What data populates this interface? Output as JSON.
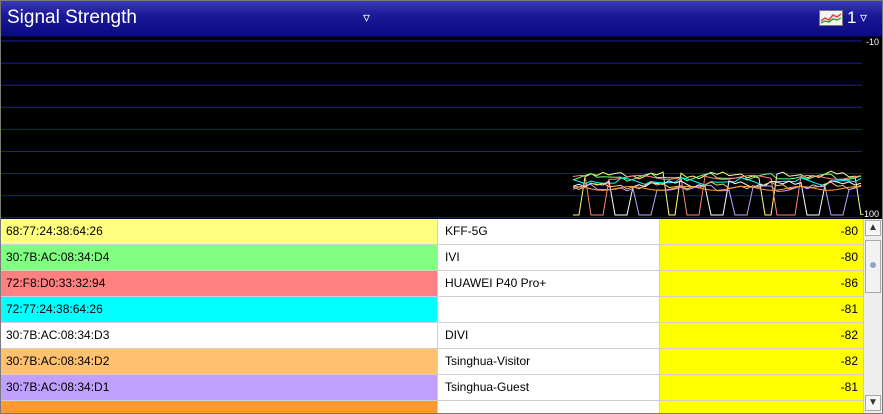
{
  "header": {
    "title": "Signal Strength",
    "title_dropdown_icon": "▿",
    "legend_icon": "legend-chart-icon",
    "legend_count": "1",
    "legend_dropdown_icon": "▿"
  },
  "graph": {
    "y_top_label": "-10",
    "y_bottom_label": "-100",
    "background": "#000000",
    "grid_color": "#1c1cb4",
    "series_colors": [
      "#ffff80",
      "#80ff80",
      "#ff8080",
      "#00ffff",
      "#ffffff",
      "#ffc070",
      "#c0a0ff",
      "#ff9933"
    ]
  },
  "rows": [
    {
      "mac": "68:77:24:38:64:26",
      "ssid": "KFF-5G",
      "rssi": "-80",
      "color": "#ffff80"
    },
    {
      "mac": "30:7B:AC:08:34:D4",
      "ssid": "IVI",
      "rssi": "-80",
      "color": "#80ff80"
    },
    {
      "mac": "72:F8:D0:33:32:94",
      "ssid": "HUAWEI P40 Pro+",
      "rssi": "-86",
      "color": "#ff8080"
    },
    {
      "mac": "72:77:24:38:64:26",
      "ssid": "",
      "rssi": "-81",
      "color": "#00ffff"
    },
    {
      "mac": "30:7B:AC:08:34:D3",
      "ssid": "DIVI",
      "rssi": "-82",
      "color": "#ffffff"
    },
    {
      "mac": "30:7B:AC:08:34:D2",
      "ssid": "Tsinghua-Visitor",
      "rssi": "-82",
      "color": "#ffc070"
    },
    {
      "mac": "30:7B:AC:08:34:D1",
      "ssid": "Tsinghua-Guest",
      "rssi": "-81",
      "color": "#c0a0ff"
    },
    {
      "mac": "",
      "ssid": "",
      "rssi": "",
      "color": "#ff9933"
    }
  ],
  "scrollbar": {
    "up_icon": "▲",
    "down_icon": "▼"
  }
}
